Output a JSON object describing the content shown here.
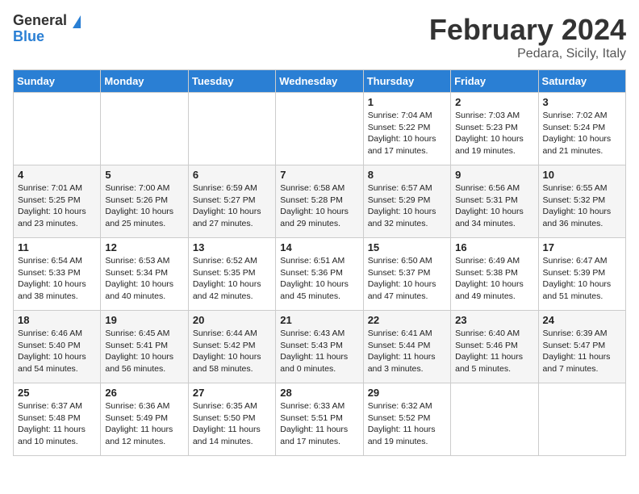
{
  "header": {
    "logo_general": "General",
    "logo_blue": "Blue",
    "month_title": "February 2024",
    "location": "Pedara, Sicily, Italy"
  },
  "weekdays": [
    "Sunday",
    "Monday",
    "Tuesday",
    "Wednesday",
    "Thursday",
    "Friday",
    "Saturday"
  ],
  "weeks": [
    [
      {
        "day": "",
        "info": ""
      },
      {
        "day": "",
        "info": ""
      },
      {
        "day": "",
        "info": ""
      },
      {
        "day": "",
        "info": ""
      },
      {
        "day": "1",
        "info": "Sunrise: 7:04 AM\nSunset: 5:22 PM\nDaylight: 10 hours\nand 17 minutes."
      },
      {
        "day": "2",
        "info": "Sunrise: 7:03 AM\nSunset: 5:23 PM\nDaylight: 10 hours\nand 19 minutes."
      },
      {
        "day": "3",
        "info": "Sunrise: 7:02 AM\nSunset: 5:24 PM\nDaylight: 10 hours\nand 21 minutes."
      }
    ],
    [
      {
        "day": "4",
        "info": "Sunrise: 7:01 AM\nSunset: 5:25 PM\nDaylight: 10 hours\nand 23 minutes."
      },
      {
        "day": "5",
        "info": "Sunrise: 7:00 AM\nSunset: 5:26 PM\nDaylight: 10 hours\nand 25 minutes."
      },
      {
        "day": "6",
        "info": "Sunrise: 6:59 AM\nSunset: 5:27 PM\nDaylight: 10 hours\nand 27 minutes."
      },
      {
        "day": "7",
        "info": "Sunrise: 6:58 AM\nSunset: 5:28 PM\nDaylight: 10 hours\nand 29 minutes."
      },
      {
        "day": "8",
        "info": "Sunrise: 6:57 AM\nSunset: 5:29 PM\nDaylight: 10 hours\nand 32 minutes."
      },
      {
        "day": "9",
        "info": "Sunrise: 6:56 AM\nSunset: 5:31 PM\nDaylight: 10 hours\nand 34 minutes."
      },
      {
        "day": "10",
        "info": "Sunrise: 6:55 AM\nSunset: 5:32 PM\nDaylight: 10 hours\nand 36 minutes."
      }
    ],
    [
      {
        "day": "11",
        "info": "Sunrise: 6:54 AM\nSunset: 5:33 PM\nDaylight: 10 hours\nand 38 minutes."
      },
      {
        "day": "12",
        "info": "Sunrise: 6:53 AM\nSunset: 5:34 PM\nDaylight: 10 hours\nand 40 minutes."
      },
      {
        "day": "13",
        "info": "Sunrise: 6:52 AM\nSunset: 5:35 PM\nDaylight: 10 hours\nand 42 minutes."
      },
      {
        "day": "14",
        "info": "Sunrise: 6:51 AM\nSunset: 5:36 PM\nDaylight: 10 hours\nand 45 minutes."
      },
      {
        "day": "15",
        "info": "Sunrise: 6:50 AM\nSunset: 5:37 PM\nDaylight: 10 hours\nand 47 minutes."
      },
      {
        "day": "16",
        "info": "Sunrise: 6:49 AM\nSunset: 5:38 PM\nDaylight: 10 hours\nand 49 minutes."
      },
      {
        "day": "17",
        "info": "Sunrise: 6:47 AM\nSunset: 5:39 PM\nDaylight: 10 hours\nand 51 minutes."
      }
    ],
    [
      {
        "day": "18",
        "info": "Sunrise: 6:46 AM\nSunset: 5:40 PM\nDaylight: 10 hours\nand 54 minutes."
      },
      {
        "day": "19",
        "info": "Sunrise: 6:45 AM\nSunset: 5:41 PM\nDaylight: 10 hours\nand 56 minutes."
      },
      {
        "day": "20",
        "info": "Sunrise: 6:44 AM\nSunset: 5:42 PM\nDaylight: 10 hours\nand 58 minutes."
      },
      {
        "day": "21",
        "info": "Sunrise: 6:43 AM\nSunset: 5:43 PM\nDaylight: 11 hours\nand 0 minutes."
      },
      {
        "day": "22",
        "info": "Sunrise: 6:41 AM\nSunset: 5:44 PM\nDaylight: 11 hours\nand 3 minutes."
      },
      {
        "day": "23",
        "info": "Sunrise: 6:40 AM\nSunset: 5:46 PM\nDaylight: 11 hours\nand 5 minutes."
      },
      {
        "day": "24",
        "info": "Sunrise: 6:39 AM\nSunset: 5:47 PM\nDaylight: 11 hours\nand 7 minutes."
      }
    ],
    [
      {
        "day": "25",
        "info": "Sunrise: 6:37 AM\nSunset: 5:48 PM\nDaylight: 11 hours\nand 10 minutes."
      },
      {
        "day": "26",
        "info": "Sunrise: 6:36 AM\nSunset: 5:49 PM\nDaylight: 11 hours\nand 12 minutes."
      },
      {
        "day": "27",
        "info": "Sunrise: 6:35 AM\nSunset: 5:50 PM\nDaylight: 11 hours\nand 14 minutes."
      },
      {
        "day": "28",
        "info": "Sunrise: 6:33 AM\nSunset: 5:51 PM\nDaylight: 11 hours\nand 17 minutes."
      },
      {
        "day": "29",
        "info": "Sunrise: 6:32 AM\nSunset: 5:52 PM\nDaylight: 11 hours\nand 19 minutes."
      },
      {
        "day": "",
        "info": ""
      },
      {
        "day": "",
        "info": ""
      }
    ]
  ]
}
